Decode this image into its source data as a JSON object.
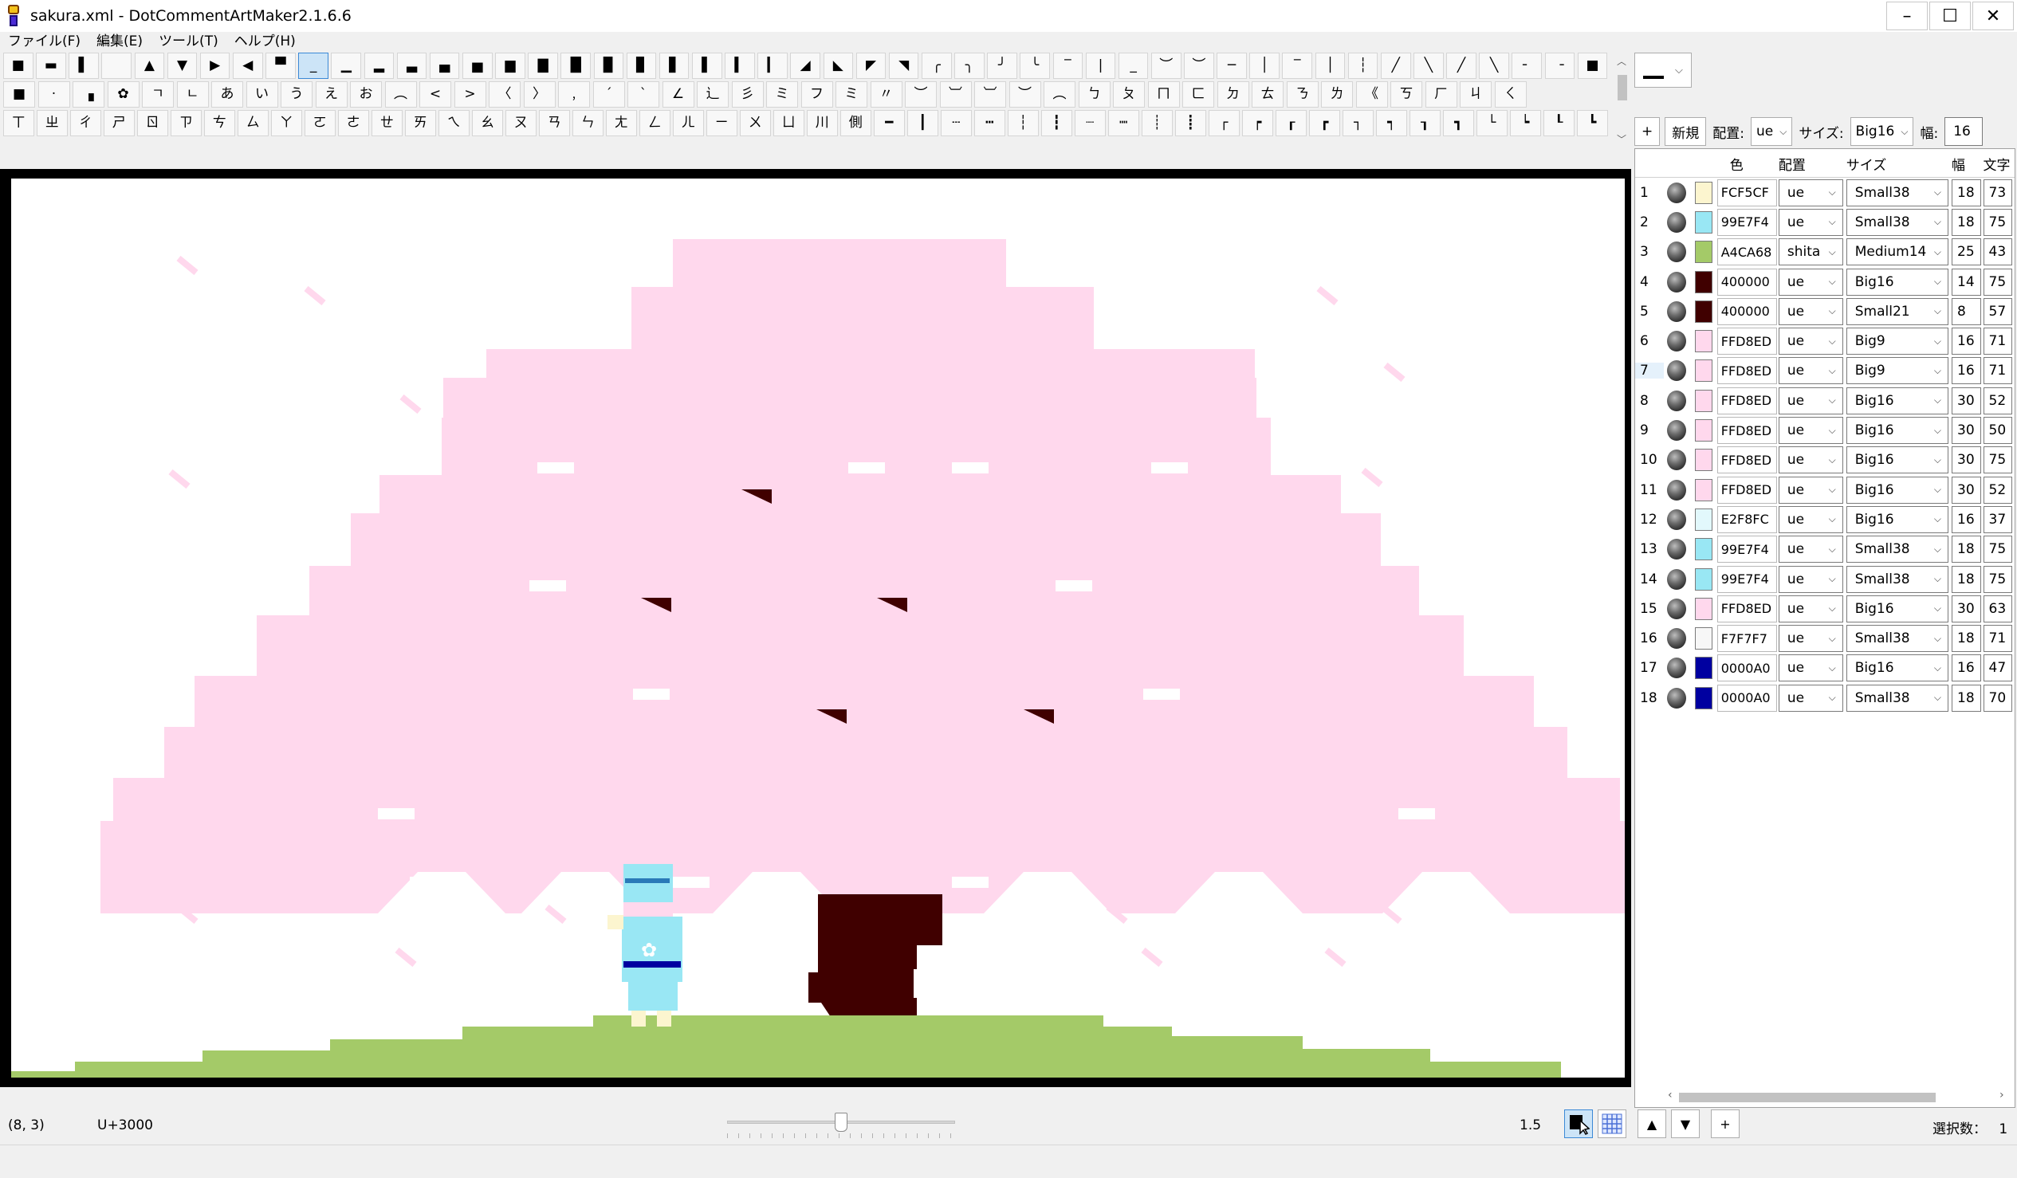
{
  "window": {
    "title": "sakura.xml - DotCommentArtMaker2.1.6.6",
    "minimize": "–",
    "maximize": "☐",
    "close": "✕"
  },
  "menu": [
    {
      "label": "ファイル(F)"
    },
    {
      "label": "編集(E)"
    },
    {
      "label": "ツール(T)"
    },
    {
      "label": "ヘルプ(H)"
    }
  ],
  "palette": {
    "rows": [
      [
        "■",
        "▬",
        "▌",
        "",
        "▲",
        "▼",
        "▶",
        "◀",
        "▀",
        "_",
        "▁",
        "▂",
        "▃",
        "▄",
        "▅",
        "▆",
        "▇",
        "█",
        "▉",
        "▊",
        "▋",
        "▌",
        "▍",
        "▎",
        "◢",
        "◣",
        "◤",
        "◥",
        "╭",
        "╮",
        "╯",
        "╰",
        "‾",
        "|",
        "_",
        "︶",
        "︶",
        "─",
        "│",
        "‾",
        "│",
        "┆",
        "╱",
        "╲",
        "╱",
        "╲",
        "╴",
        "╶",
        "■"
      ],
      [
        "■",
        "·",
        "▗",
        "✿",
        "ㄱ",
        "ㄴ",
        "あ",
        "い",
        "う",
        "え",
        "お",
        "︵",
        "<",
        ">",
        "〈",
        "〉",
        "﹐",
        "ˊ",
        "ˋ",
        "∠",
        "辶",
        "彡",
        "ミ",
        "フ",
        "ミ",
        "〃",
        "︶",
        "︺",
        "︺",
        "︶",
        "︵",
        "ㄅ",
        "ㄆ",
        "ㄇ",
        "ㄈ",
        "ㄉ",
        "ㄊ",
        "ㄋ",
        "ㄌ",
        "《",
        "ㄎ",
        "ㄏ",
        "ㄐ",
        "ㄑ"
      ],
      [
        "ㄒ",
        "ㄓ",
        "ㄔ",
        "ㄕ",
        "ㄖ",
        "ㄗ",
        "ㄘ",
        "ㄙ",
        "ㄚ",
        "ㄛ",
        "ㄜ",
        "ㄝ",
        "ㄞ",
        "ㄟ",
        "ㄠ",
        "ㄡ",
        "ㄢ",
        "ㄣ",
        "ㄤ",
        "ㄥ",
        "ㄦ",
        "ㄧ",
        "ㄨ",
        "ㄩ",
        "川",
        "側",
        "━",
        "┃",
        "┄",
        "┅",
        "┆",
        "┇",
        "┈",
        "┉",
        "┊",
        "┋",
        "┌",
        "┍",
        "┎",
        "┏",
        "┐",
        "┑",
        "┒",
        "┓",
        "└",
        "┕",
        "┖",
        "┗"
      ]
    ],
    "selected_index": 9
  },
  "glyph_selector": {
    "value": "▁"
  },
  "layer_toolbar": {
    "add": "+",
    "new": "新規",
    "placement_label": "配置:",
    "placement_value": "ue",
    "size_label": "サイズ:",
    "size_value": "Big16",
    "width_label": "幅:",
    "width_value": "16"
  },
  "layer_table": {
    "headers": {
      "color": "色",
      "placement": "配置",
      "size": "サイズ",
      "width": "幅",
      "chars": "文字"
    },
    "rows": [
      {
        "n": "1",
        "color": "FCF5CF",
        "pos": "ue",
        "size": "Small38",
        "w": "18",
        "ch": "73"
      },
      {
        "n": "2",
        "color": "99E7F4",
        "pos": "ue",
        "size": "Small38",
        "w": "18",
        "ch": "75"
      },
      {
        "n": "3",
        "color": "A4CA68",
        "pos": "shita",
        "size": "Medium14",
        "w": "25",
        "ch": "43"
      },
      {
        "n": "4",
        "color": "400000",
        "pos": "ue",
        "size": "Big16",
        "w": "14",
        "ch": "75"
      },
      {
        "n": "5",
        "color": "400000",
        "pos": "ue",
        "size": "Small21",
        "w": "8",
        "ch": "57"
      },
      {
        "n": "6",
        "color": "FFD8ED",
        "pos": "ue",
        "size": "Big9",
        "w": "16",
        "ch": "71"
      },
      {
        "n": "7",
        "color": "FFD8ED",
        "pos": "ue",
        "size": "Big9",
        "w": "16",
        "ch": "71"
      },
      {
        "n": "8",
        "color": "FFD8ED",
        "pos": "ue",
        "size": "Big16",
        "w": "30",
        "ch": "52"
      },
      {
        "n": "9",
        "color": "FFD8ED",
        "pos": "ue",
        "size": "Big16",
        "w": "30",
        "ch": "50"
      },
      {
        "n": "10",
        "color": "FFD8ED",
        "pos": "ue",
        "size": "Big16",
        "w": "30",
        "ch": "75"
      },
      {
        "n": "11",
        "color": "FFD8ED",
        "pos": "ue",
        "size": "Big16",
        "w": "30",
        "ch": "52"
      },
      {
        "n": "12",
        "color": "E2F8FC",
        "pos": "ue",
        "size": "Big16",
        "w": "16",
        "ch": "37"
      },
      {
        "n": "13",
        "color": "99E7F4",
        "pos": "ue",
        "size": "Small38",
        "w": "18",
        "ch": "75"
      },
      {
        "n": "14",
        "color": "99E7F4",
        "pos": "ue",
        "size": "Small38",
        "w": "18",
        "ch": "75"
      },
      {
        "n": "15",
        "color": "FFD8ED",
        "pos": "ue",
        "size": "Big16",
        "w": "30",
        "ch": "63"
      },
      {
        "n": "16",
        "color": "F7F7F7",
        "pos": "ue",
        "size": "Small38",
        "w": "18",
        "ch": "71"
      },
      {
        "n": "17",
        "color": "0000A0",
        "pos": "ue",
        "size": "Big16",
        "w": "16",
        "ch": "47"
      },
      {
        "n": "18",
        "color": "0000A0",
        "pos": "ue",
        "size": "Small38",
        "w": "18",
        "ch": "70"
      }
    ],
    "selected_row": 7
  },
  "status": {
    "coord": "(8, 3)",
    "code": "U+3000",
    "slider_value": 0.5,
    "zoom": "1.5",
    "selection_label": "選択数：",
    "selection_count": "1"
  },
  "layer_buttons": {
    "up": "▲",
    "down": "▼",
    "add": "+"
  },
  "colors": {
    "blossom": "#FFD8ED",
    "trunk": "#400000",
    "grass": "#A4CA68",
    "kimono": "#99E7F4",
    "skin": "#FCF5CF",
    "sash": "#0000A0",
    "highlight": "#cce4f7"
  },
  "icons": {
    "pen_tool": "pen-tool-icon",
    "grid_tool": "grid-icon",
    "visibility": "visibility-ball-icon"
  }
}
